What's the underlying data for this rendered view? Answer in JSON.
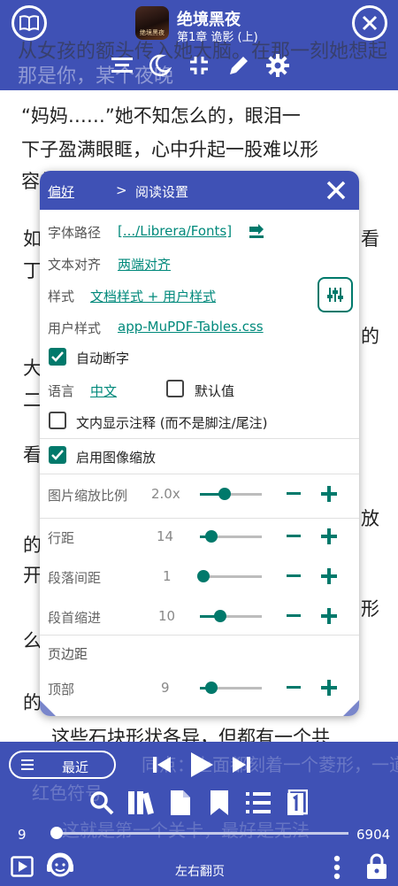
{
  "top": {
    "book_title": "绝境黑夜",
    "chapter": "第1章 诡影 (上)",
    "cover_text": "绝境黑夜",
    "ghost_text": "从女孩的额头传入她大脑。在那一刻她想起了",
    "ghost_text2": "那是你，某个夜晚"
  },
  "reader": {
    "para1_line1": "“妈妈……”她不知怎么的，眼泪一",
    "para1_line2": "下子盈满眼眶，心中升起一股难以形",
    "para1_line3": "容的痛楚。",
    "margin_glyphs": [
      "如",
      "丁",
      "大",
      "二",
      "看",
      "的",
      "开",
      "么",
      "的"
    ],
    "right_glyphs": [
      "看",
      "的",
      "放",
      "形"
    ],
    "para_bottom": "这些石块形状各异，但都有一个共",
    "ghost_bottom1": "同点：上面都刻着一个菱形，一道奇特的",
    "ghost_bottom2": "红色符号",
    "ghost_bottom3": "这就是第一个关卡，最好是无法"
  },
  "dialog": {
    "breadcrumb_pref": "偏好",
    "breadcrumb_arrow": ">",
    "title": "阅读设置",
    "font_path_label": "字体路径",
    "font_path_value": "[.../Librera/Fonts]",
    "text_align_label": "文本对齐",
    "text_align_value": "两端对齐",
    "style_label": "样式",
    "style_value": "文档样式 + 用户样式",
    "user_style_label": "用户样式",
    "user_style_value": "app-MuPDF-Tables.css",
    "hyphen_label": "自动断字",
    "hyphen_checked": true,
    "lang_label": "语言",
    "lang_value": "中文",
    "default_label": "默认值",
    "default_checked": false,
    "notes_label": "文内显示注释 (而不是脚注/尾注)",
    "notes_checked": false,
    "image_zoom_label": "启用图像缩放",
    "image_zoom_checked": true,
    "image_scale_label": "图片缩放比例",
    "image_scale_value": "2.0x",
    "image_scale_level": 0.4,
    "line_spacing_label": "行距",
    "line_spacing_value": "14",
    "line_spacing_level": 0.18,
    "para_spacing_label": "段落间距",
    "para_spacing_value": "1",
    "para_spacing_level": 0.05,
    "indent_label": "段首缩进",
    "indent_value": "10",
    "indent_level": 0.33,
    "margins_label": "页边距",
    "top_label": "顶部",
    "top_value": "9",
    "top_level": 0.18,
    "minus_symbol": "−",
    "plus_symbol": "+"
  },
  "bottom": {
    "recent_label": "最近",
    "page_current": "9",
    "page_total": "6904",
    "page_progress": 0.001,
    "flip_mode": "左右翻页"
  },
  "colors": {
    "primary": "#3F51B5",
    "accent": "#00796B"
  }
}
